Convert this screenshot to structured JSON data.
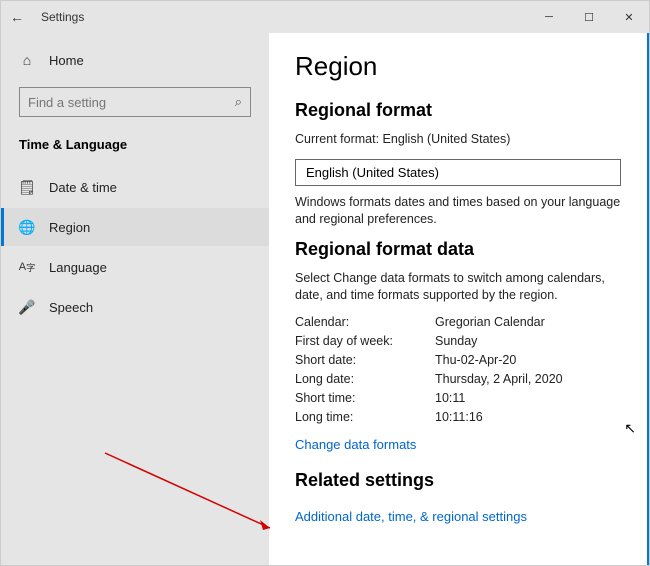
{
  "titlebar": {
    "title": "Settings"
  },
  "sidebar": {
    "home": "Home",
    "search_placeholder": "Find a setting",
    "section": "Time & Language",
    "items": [
      {
        "label": "Date & time",
        "icon": "🗒"
      },
      {
        "label": "Region",
        "icon": "🌐"
      },
      {
        "label": "Language",
        "icon": "A字"
      },
      {
        "label": "Speech",
        "icon": "🎤"
      }
    ]
  },
  "content": {
    "heading": "Region",
    "format_heading": "Regional format",
    "current_format_label": "Current format: English (United States)",
    "dropdown_value": "English (United States)",
    "format_desc": "Windows formats dates and times based on your language and regional preferences.",
    "data_heading": "Regional format data",
    "data_desc": "Select Change data formats to switch among calendars, date, and time formats supported by the region.",
    "rows": [
      {
        "k": "Calendar:",
        "v": "Gregorian Calendar"
      },
      {
        "k": "First day of week:",
        "v": "Sunday"
      },
      {
        "k": "Short date:",
        "v": "Thu-02-Apr-20"
      },
      {
        "k": "Long date:",
        "v": "Thursday, 2 April, 2020"
      },
      {
        "k": "Short time:",
        "v": "10:11"
      },
      {
        "k": "Long time:",
        "v": "10:11:16"
      }
    ],
    "change_link": "Change data formats",
    "related_heading": "Related settings",
    "related_link": "Additional date, time, & regional settings"
  }
}
